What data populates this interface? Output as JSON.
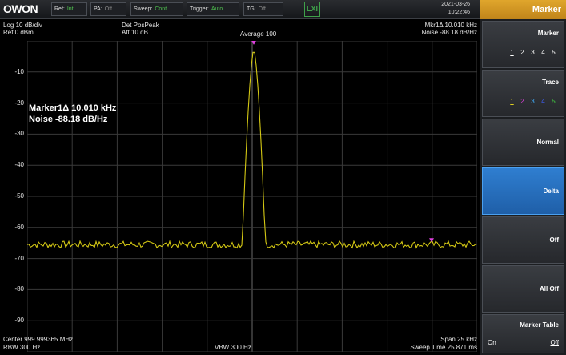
{
  "topbar": {
    "logo": "OWON",
    "ref_label": "Ref:",
    "ref_value": "Int",
    "pa_label": "PA:",
    "pa_value": "Off",
    "sweep_label": "Sweep:",
    "sweep_value": "Cont.",
    "trigger_label": "Trigger:",
    "trigger_value": "Auto",
    "tg_label": "TG:",
    "tg_value": "Off",
    "lxi": "LXI",
    "date": "2021-03-26",
    "time": "10:22:46",
    "panel_title": "Marker"
  },
  "header": {
    "scale": "Log 10 dB/div",
    "ref_level": "Ref 0 dBm",
    "detector": "Det PosPeak",
    "atten": "Att 10 dB",
    "average": "Average 100",
    "marker_delta": "Mkr1Δ  10.010 kHz",
    "marker_noise": "Noise  -88.18 dB/Hz"
  },
  "readout": {
    "line1": "Marker1Δ  10.010 kHz",
    "line2": "Noise  -88.18 dB/Hz"
  },
  "y_axis": [
    "-10",
    "-20",
    "-30",
    "-40",
    "-50",
    "-60",
    "-70",
    "-80",
    "-90"
  ],
  "footer": {
    "center": "Center 999.999365 MHz",
    "rbw": "RBW 300 Hz",
    "vbw": "VBW 300 Hz",
    "span": "Span 25 kHz",
    "sweep_time": "Sweep Time 25.871 ms"
  },
  "softkeys": {
    "marker": {
      "label": "Marker",
      "options": [
        "1",
        "2",
        "3",
        "4",
        "5"
      ],
      "selected": "1"
    },
    "trace": {
      "label": "Trace",
      "options": [
        "1",
        "2",
        "3",
        "4",
        "5"
      ],
      "selected": "1",
      "colors": [
        "#e0d020",
        "#e040e0",
        "#40b0ff",
        "#4060ff",
        "#40d040"
      ]
    },
    "normal": "Normal",
    "delta": "Delta",
    "off": "Off",
    "all_off": "All Off",
    "marker_table": {
      "label": "Marker Table",
      "on": "On",
      "off": "Off"
    }
  },
  "colors": {
    "trace": "#d4c814",
    "grid": "#3a3a3a",
    "marker": "#e040e0",
    "accent": "#2f7ed0"
  }
}
